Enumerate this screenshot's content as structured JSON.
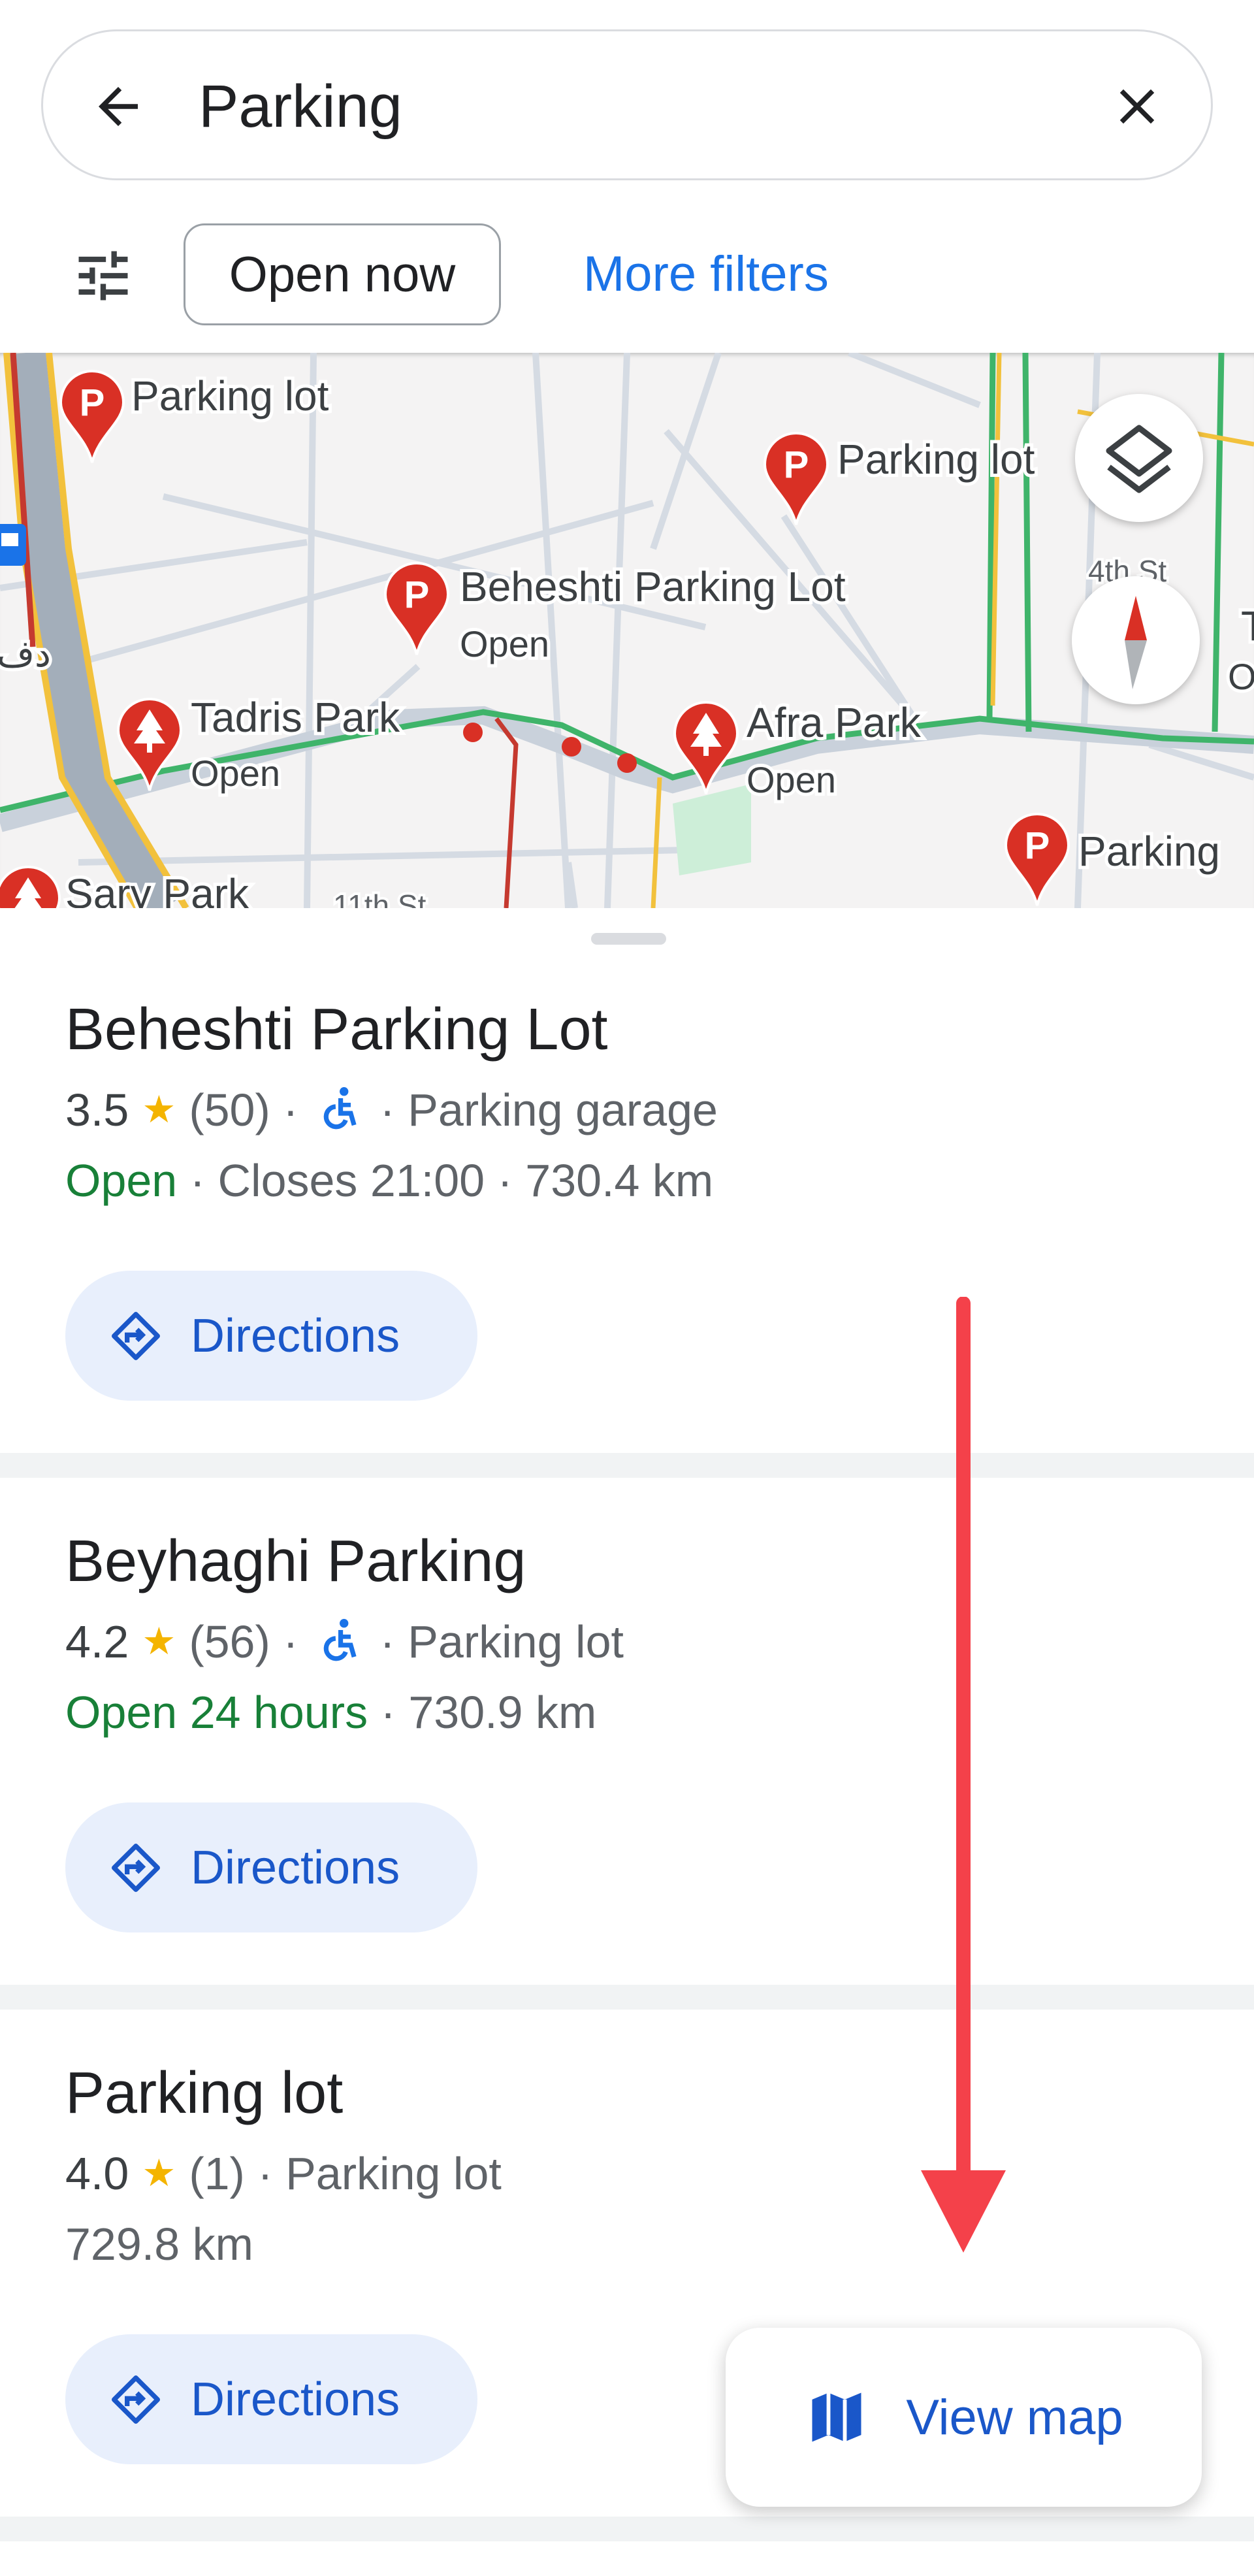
{
  "search": {
    "query": "Parking",
    "back_icon": "arrow-left-icon",
    "clear_icon": "close-icon"
  },
  "filters": {
    "icon": "tune-sliders-icon",
    "chip_open_now": "Open now",
    "more_filters": "More filters"
  },
  "map": {
    "labels": {
      "pin1": "Parking lot",
      "pin2": "Parking lot",
      "pin3": "Beheshti Parking Lot",
      "pin3_sub": "Open",
      "pin4": "Tadris Park",
      "pin4_sub": "Open",
      "pin5": "Afra Park",
      "pin5_sub": "Open",
      "pin6": "Parking",
      "pin7": "Sary Park",
      "street1": "4th St",
      "street2": "11th St",
      "edge1": "Tak",
      "edge1_sub": "Op",
      "arabic": "دف"
    },
    "layers_icon": "layers-icon",
    "compass_icon": "compass-icon"
  },
  "results": [
    {
      "title": "Beheshti Parking Lot",
      "rating": "3.5",
      "reviews": "(50)",
      "accessible": true,
      "category": "Parking garage",
      "status": "Open",
      "hours": "Closes 21:00",
      "distance": "730.4 km",
      "directions": "Directions"
    },
    {
      "title": "Beyhaghi Parking",
      "rating": "4.2",
      "reviews": "(56)",
      "accessible": true,
      "category": "Parking lot",
      "status": "Open 24 hours",
      "distance": "730.9 km",
      "directions": "Directions"
    },
    {
      "title": "Parking lot",
      "rating": "4.0",
      "reviews": "(1)",
      "accessible": false,
      "category": "Parking lot",
      "distance": "729.8 km",
      "directions": "Directions"
    }
  ],
  "view_map": {
    "label": "View map",
    "icon": "map-icon"
  },
  "colors": {
    "accent": "#1a73e8",
    "open": "#188038",
    "star": "#f4b400",
    "pin": "#d93025",
    "annotation_arrow": "#f4414a"
  },
  "sep": " · ",
  "star_glyph": "★"
}
